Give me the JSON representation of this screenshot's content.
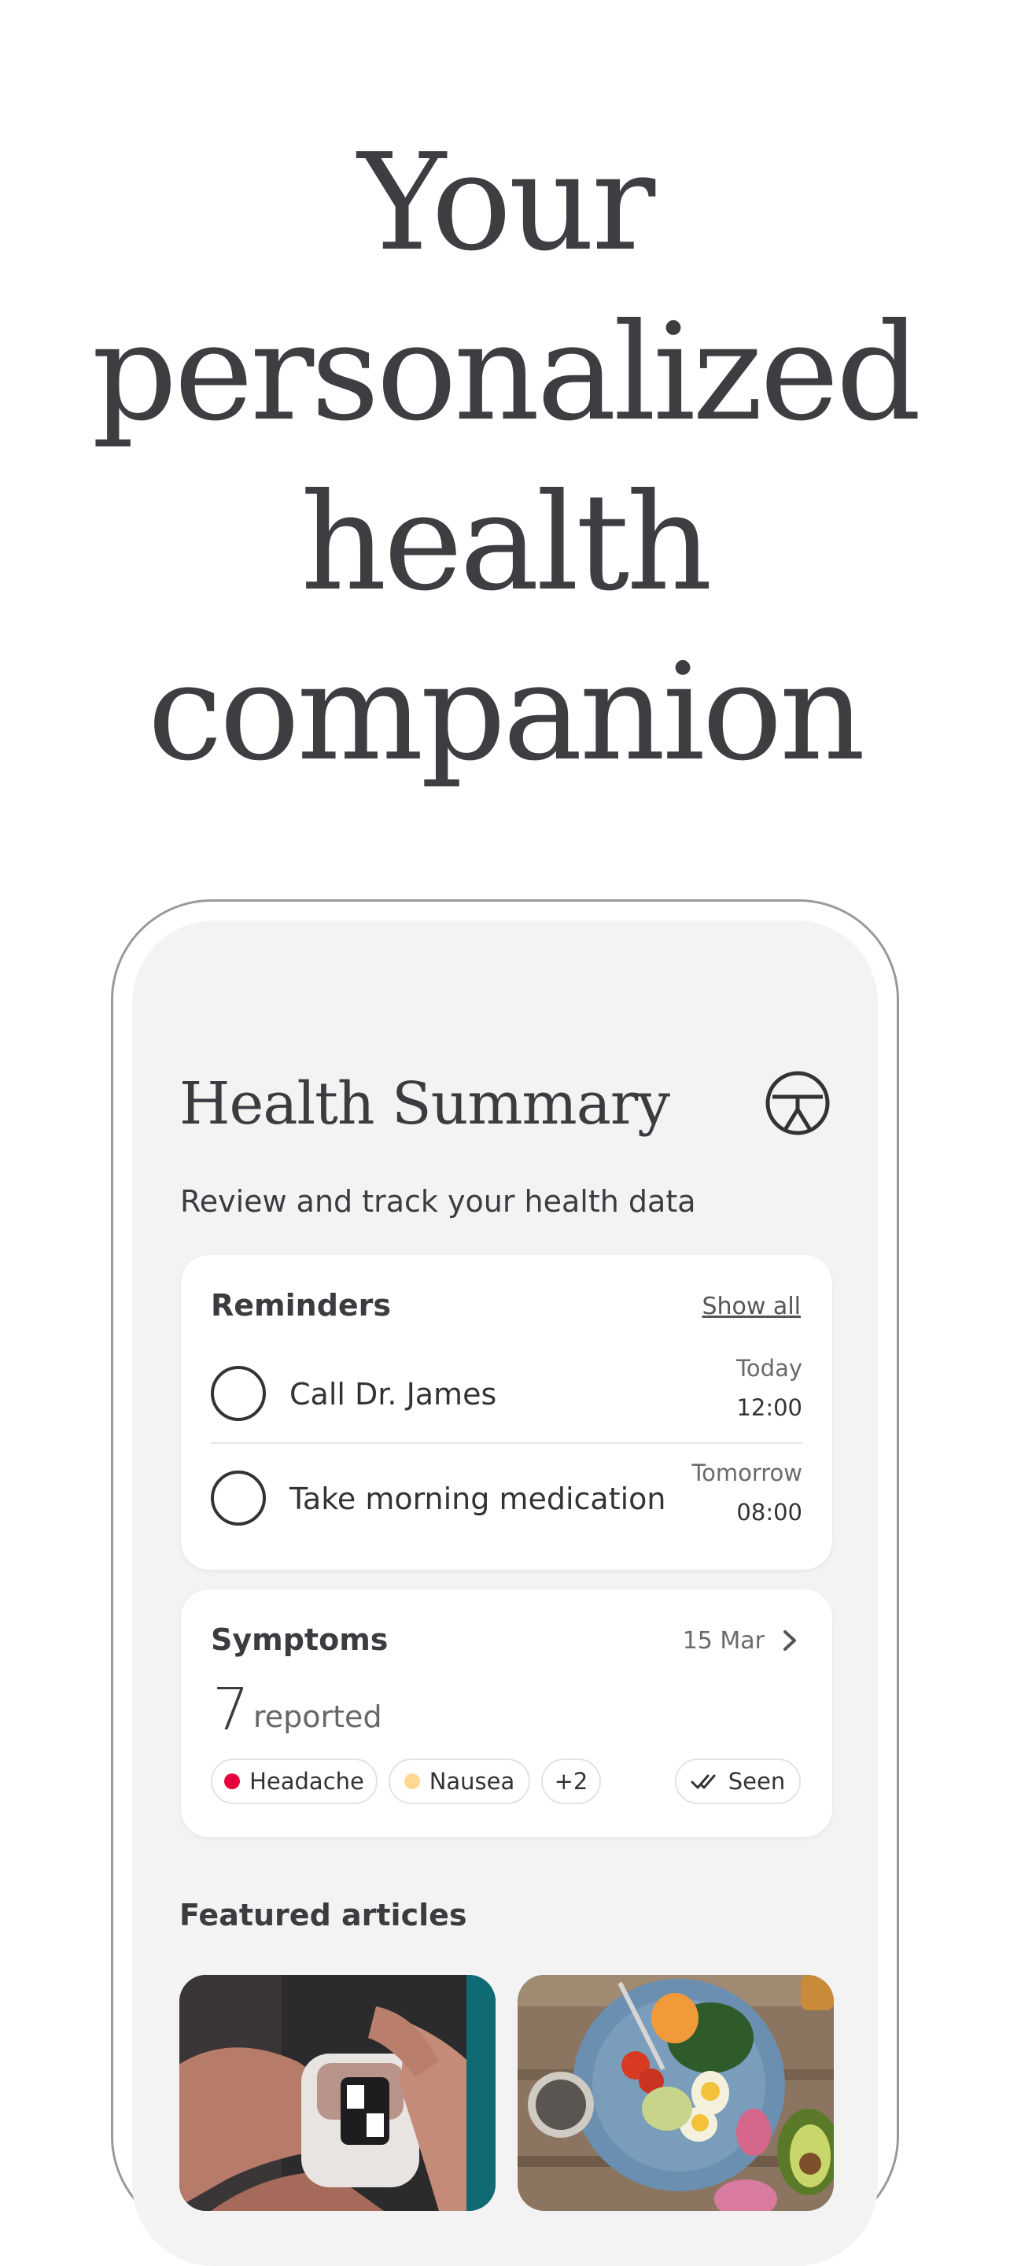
{
  "hero": {
    "lines": [
      "Your",
      "personalized",
      "health",
      "companion"
    ]
  },
  "app": {
    "title": "Health Summary",
    "subtitle": "Review and track your health data",
    "profile_icon": "body-figure-icon"
  },
  "reminders": {
    "title": "Reminders",
    "show_all": "Show all",
    "items": [
      {
        "label": "Call Dr. James",
        "day": "Today",
        "time": "12:00"
      },
      {
        "label": "Take morning medication",
        "day": "Tomorrow",
        "time": "08:00"
      }
    ]
  },
  "symptoms": {
    "title": "Symptoms",
    "date": "15 Mar",
    "count": "7",
    "count_label": "reported",
    "chips": [
      {
        "label": "Headache",
        "color": "#e4003a"
      },
      {
        "label": "Nausea",
        "color": "#ffd991"
      }
    ],
    "more": "+2",
    "seen": "Seen"
  },
  "articles": {
    "title": "Featured articles",
    "items": [
      {
        "image": "pulse-oximeter-photo"
      },
      {
        "image": "healthy-salad-photo"
      }
    ]
  }
}
